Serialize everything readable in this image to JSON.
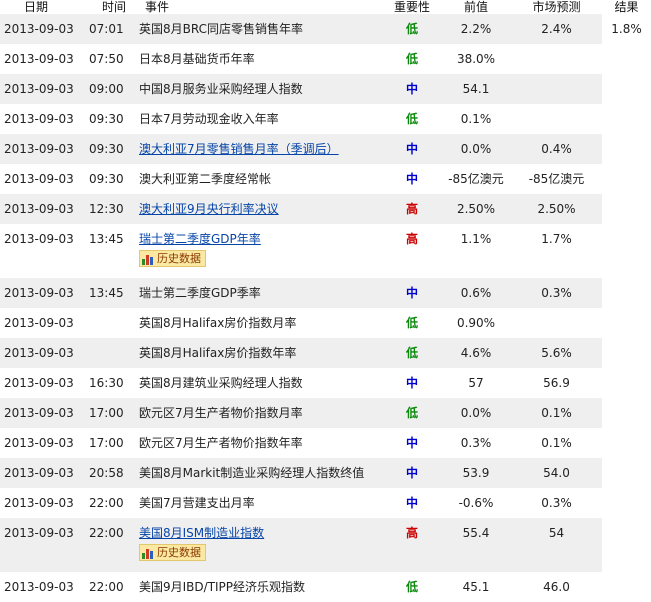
{
  "headers": {
    "date": "日期",
    "time": "时间",
    "event": "事件",
    "importance": "重要性",
    "previous": "前值",
    "forecast": "市场预测",
    "actual": "结果"
  },
  "history_label": "历史数据",
  "colors": {
    "low": "#0a8a0a",
    "mid": "#0000cc",
    "high": "#cc0000",
    "link": "#0645a8",
    "stripe": "#efefef"
  },
  "rows": [
    {
      "date": "2013-09-03",
      "time": "07:01",
      "event": "英国8月BRC同店零售销售年率",
      "link": false,
      "importance": "低",
      "level": "low",
      "previous": "2.2%",
      "forecast": "2.4%",
      "actual": "1.8%",
      "history": false
    },
    {
      "date": "2013-09-03",
      "time": "07:50",
      "event": "日本8月基础货币年率",
      "link": false,
      "importance": "低",
      "level": "low",
      "previous": "38.0%",
      "forecast": "",
      "actual": "",
      "history": false
    },
    {
      "date": "2013-09-03",
      "time": "09:00",
      "event": "中国8月服务业采购经理人指数",
      "link": false,
      "importance": "中",
      "level": "mid",
      "previous": "54.1",
      "forecast": "",
      "actual": "",
      "history": false
    },
    {
      "date": "2013-09-03",
      "time": "09:30",
      "event": "日本7月劳动现金收入年率",
      "link": false,
      "importance": "低",
      "level": "low",
      "previous": "0.1%",
      "forecast": "",
      "actual": "",
      "history": false
    },
    {
      "date": "2013-09-03",
      "time": "09:30",
      "event": "澳大利亚7月零售销售月率（季调后）",
      "link": true,
      "importance": "中",
      "level": "mid",
      "previous": "0.0%",
      "forecast": "0.4%",
      "actual": "",
      "history": false
    },
    {
      "date": "2013-09-03",
      "time": "09:30",
      "event": "澳大利亚第二季度经常帐",
      "link": false,
      "importance": "中",
      "level": "mid",
      "previous": "-85亿澳元",
      "forecast": "-85亿澳元",
      "actual": "",
      "history": false
    },
    {
      "date": "2013-09-03",
      "time": "12:30",
      "event": "澳大利亚9月央行利率决议",
      "link": true,
      "importance": "高",
      "level": "high",
      "previous": "2.50%",
      "forecast": "2.50%",
      "actual": "",
      "history": false
    },
    {
      "date": "2013-09-03",
      "time": "13:45",
      "event": "瑞士第二季度GDP年率",
      "link": true,
      "importance": "高",
      "level": "high",
      "previous": "1.1%",
      "forecast": "1.7%",
      "actual": "",
      "history": true
    },
    {
      "date": "2013-09-03",
      "time": "13:45",
      "event": "瑞士第二季度GDP季率",
      "link": false,
      "importance": "中",
      "level": "mid",
      "previous": "0.6%",
      "forecast": "0.3%",
      "actual": "",
      "history": false
    },
    {
      "date": "2013-09-03",
      "time": "",
      "event": "英国8月Halifax房价指数月率",
      "link": false,
      "importance": "低",
      "level": "low",
      "previous": "0.90%",
      "forecast": "",
      "actual": "",
      "history": false
    },
    {
      "date": "2013-09-03",
      "time": "",
      "event": "英国8月Halifax房价指数年率",
      "link": false,
      "importance": "低",
      "level": "low",
      "previous": "4.6%",
      "forecast": "5.6%",
      "actual": "",
      "history": false
    },
    {
      "date": "2013-09-03",
      "time": "16:30",
      "event": "英国8月建筑业采购经理人指数",
      "link": false,
      "importance": "中",
      "level": "mid",
      "previous": "57",
      "forecast": "56.9",
      "actual": "",
      "history": false
    },
    {
      "date": "2013-09-03",
      "time": "17:00",
      "event": "欧元区7月生产者物价指数月率",
      "link": false,
      "importance": "低",
      "level": "low",
      "previous": "0.0%",
      "forecast": "0.1%",
      "actual": "",
      "history": false
    },
    {
      "date": "2013-09-03",
      "time": "17:00",
      "event": "欧元区7月生产者物价指数年率",
      "link": false,
      "importance": "中",
      "level": "mid",
      "previous": "0.3%",
      "forecast": "0.1%",
      "actual": "",
      "history": false
    },
    {
      "date": "2013-09-03",
      "time": "20:58",
      "event": "美国8月Markit制造业采购经理人指数终值",
      "link": false,
      "importance": "中",
      "level": "mid",
      "previous": "53.9",
      "forecast": "54.0",
      "actual": "",
      "history": false
    },
    {
      "date": "2013-09-03",
      "time": "22:00",
      "event": "美国7月营建支出月率",
      "link": false,
      "importance": "中",
      "level": "mid",
      "previous": "-0.6%",
      "forecast": "0.3%",
      "actual": "",
      "history": false
    },
    {
      "date": "2013-09-03",
      "time": "22:00",
      "event": "美国8月ISM制造业指数",
      "link": true,
      "importance": "高",
      "level": "high",
      "previous": "55.4",
      "forecast": "54",
      "actual": "",
      "history": true
    },
    {
      "date": "2013-09-03",
      "time": "22:00",
      "event": "美国9月IBD/TIPP经济乐观指数",
      "link": false,
      "importance": "低",
      "level": "low",
      "previous": "45.1",
      "forecast": "46.0",
      "actual": "",
      "history": false
    }
  ]
}
